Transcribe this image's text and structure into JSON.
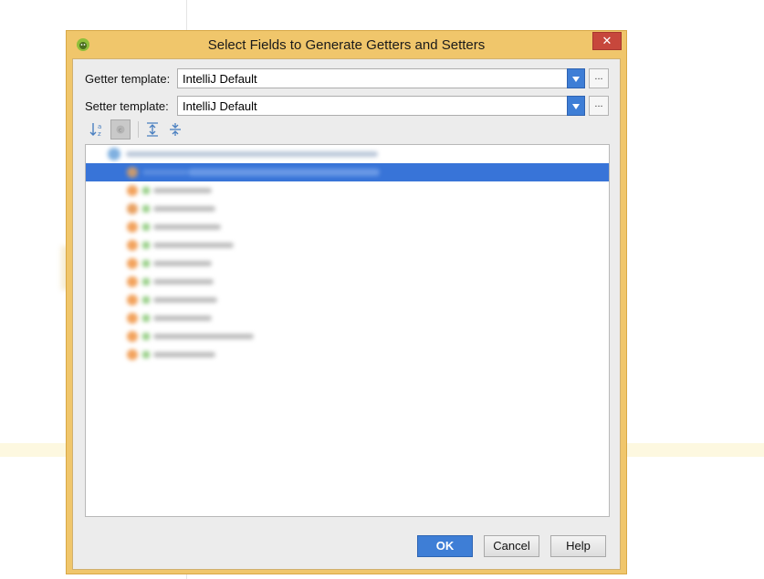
{
  "window": {
    "title": "Select Fields to Generate Getters and Setters",
    "close_glyph": "✕",
    "app_icon": "android-icon"
  },
  "getter": {
    "label": "Getter template:",
    "value": "IntelliJ Default",
    "more_label": "..."
  },
  "setter": {
    "label": "Setter template:",
    "value": "IntelliJ Default",
    "more_label": "..."
  },
  "toolbar": {
    "icons": [
      "sort-alphabetically-icon",
      "show-classes-icon",
      "expand-all-icon",
      "collapse-all-icon"
    ]
  },
  "tree": {
    "class_node": "",
    "fields": [
      {
        "name": "",
        "selected": true
      },
      {
        "name": ""
      },
      {
        "name": ""
      },
      {
        "name": ""
      },
      {
        "name": ""
      },
      {
        "name": ""
      },
      {
        "name": ""
      },
      {
        "name": ""
      },
      {
        "name": ""
      },
      {
        "name": ""
      },
      {
        "name": ""
      }
    ]
  },
  "buttons": {
    "ok": "OK",
    "cancel": "Cancel",
    "help": "Help"
  },
  "colors": {
    "window_frame": "#f0c66b",
    "accent_blue": "#3e7ed6",
    "selection": "#3874d8",
    "close_red": "#c7473c"
  }
}
